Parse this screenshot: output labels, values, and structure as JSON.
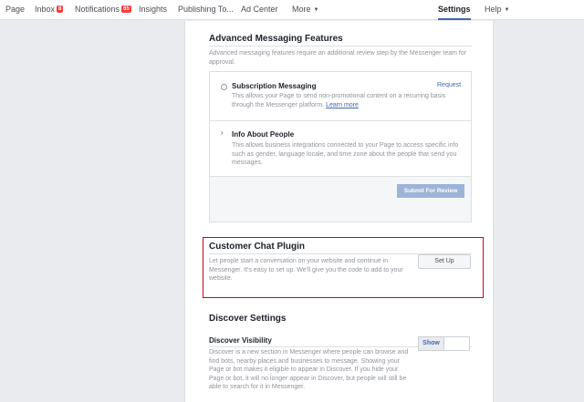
{
  "nav": {
    "page": "Page",
    "inbox": "Inbox",
    "inbox_badge": "8",
    "notifications": "Notifications",
    "notifications_badge": "65",
    "insights": "Insights",
    "publishing": "Publishing To...",
    "ad_center": "Ad Center",
    "more": "More",
    "settings": "Settings",
    "help": "Help",
    "caret": "▼"
  },
  "advanced": {
    "title": "Advanced Messaging Features",
    "description": "Advanced messaging features require an additional review step by the Messenger team for approval.",
    "subscription": {
      "title": "Subscription Messaging",
      "request": "Request",
      "desc_line1": "This allows your Page to send non-promotional content on a recurring basis",
      "desc_line2_prefix": "through the Messenger platform.",
      "learn_more": "Learn more"
    },
    "people": {
      "chevron": "›",
      "title": "Info About People",
      "description": "This allows business integrations connected to your Page to access specific info such as gender, language locale, and time zone about the people that send you messages."
    },
    "submit": "Submit For Review"
  },
  "chat_plugin": {
    "title": "Customer Chat Plugin",
    "description": "Let people start a conversation on your website and continue in Messenger. It's easy to set up. We'll give you the code to add to your website.",
    "setup": "Set Up"
  },
  "discover": {
    "title": "Discover Settings",
    "visibility_title": "Discover Visibility",
    "description": "Discover is a new section in Messenger where people can browse and find bots, nearby places and businesses to message. Showing your Page or bot makes it eligible to appear in Discover. If you hide your Page or bot, it will no longer appear in Discover, but people will still be able to search for it in Messenger.",
    "show": "Show"
  },
  "colors": {
    "accent": "#4267b2",
    "highlight": "#d0021b",
    "badge": "#fa3e3e"
  }
}
